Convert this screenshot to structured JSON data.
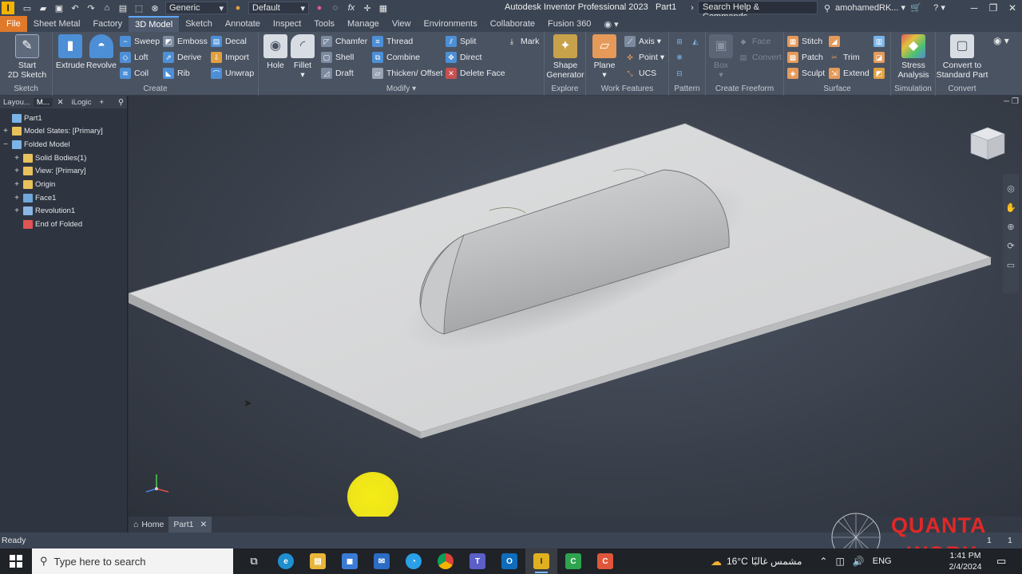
{
  "titlebar": {
    "app_title": "Autodesk Inventor Professional 2023",
    "doc_name": "Part1",
    "material": "Generic",
    "appearance": "Default",
    "search_placeholder": "Search Help & Commands...",
    "user": "amohamedRK..."
  },
  "tabs": [
    "File",
    "Sheet Metal",
    "Factory",
    "3D Model",
    "Sketch",
    "Annotate",
    "Inspect",
    "Tools",
    "Manage",
    "View",
    "Environments",
    "Collaborate",
    "Fusion 360"
  ],
  "ribbon": {
    "sketch": {
      "label": "Sketch",
      "start": "Start",
      "sketch2d": "2D Sketch"
    },
    "create": {
      "label": "Create",
      "extrude": "Extrude",
      "revolve": "Revolve",
      "sweep": "Sweep",
      "loft": "Loft",
      "coil": "Coil",
      "emboss": "Emboss",
      "derive": "Derive",
      "rib": "Rib",
      "decal": "Decal",
      "import": "Import",
      "unwrap": "Unwrap"
    },
    "modify": {
      "label": "Modify",
      "hole": "Hole",
      "fillet": "Fillet",
      "chamfer": "Chamfer",
      "shell": "Shell",
      "draft": "Draft",
      "thread": "Thread",
      "combine": "Combine",
      "thicken": "Thicken/ Offset",
      "split": "Split",
      "direct": "Direct",
      "delete_face": "Delete Face",
      "mark": "Mark"
    },
    "explore": {
      "label": "Explore",
      "shape1": "Shape",
      "shape2": "Generator"
    },
    "work": {
      "label": "Work Features",
      "plane": "Plane",
      "axis": "Axis",
      "point": "Point",
      "ucs": "UCS"
    },
    "pattern": {
      "label": "Pattern"
    },
    "freeform": {
      "label": "Create Freeform",
      "box": "Box",
      "face": "Face",
      "convert": "Convert"
    },
    "surface": {
      "label": "Surface",
      "stitch": "Stitch",
      "patch": "Patch",
      "sculpt": "Sculpt",
      "trim": "Trim",
      "extend": "Extend"
    },
    "simulation": {
      "label": "Simulation",
      "stress1": "Stress",
      "stress2": "Analysis"
    },
    "convert": {
      "label": "Convert",
      "c1": "Convert to",
      "c2": "Standard Part"
    }
  },
  "browser": {
    "tabs": [
      "Layou...",
      "M...",
      "iLogic"
    ],
    "tree": [
      {
        "label": "Part1",
        "indent": 0,
        "exp": "",
        "color": "#7ab4e8"
      },
      {
        "label": "Model States: [Primary]",
        "indent": 0,
        "exp": "+",
        "color": "#e8c15a"
      },
      {
        "label": "Folded Model",
        "indent": 0,
        "exp": "−",
        "color": "#7ab4e8"
      },
      {
        "label": "Solid Bodies(1)",
        "indent": 1,
        "exp": "+",
        "color": "#e8c15a"
      },
      {
        "label": "View: [Primary]",
        "indent": 1,
        "exp": "+",
        "color": "#e8c15a"
      },
      {
        "label": "Origin",
        "indent": 1,
        "exp": "+",
        "color": "#e8c15a"
      },
      {
        "label": "Face1",
        "indent": 1,
        "exp": "+",
        "color": "#6fa8dc"
      },
      {
        "label": "Revolution1",
        "indent": 1,
        "exp": "+",
        "color": "#8ab6e6"
      },
      {
        "label": "End of Folded",
        "indent": 1,
        "exp": "",
        "color": "#e05454"
      }
    ]
  },
  "doctabs": {
    "home": "Home",
    "part": "Part1"
  },
  "status": {
    "text": "Ready",
    "count1": "1",
    "count2": "1"
  },
  "taskbar": {
    "search_placeholder": "Type here to search",
    "weather": "16°C",
    "weather_desc": "مشمس غالبًا",
    "lang": "ENG",
    "time": "1:41 PM",
    "date": "2/4/2024"
  },
  "watermark": {
    "line1": "QUANTA",
    "line2": "WORX"
  },
  "colors": {
    "accent": "#e07a2a",
    "active_tab": "#5ea8ff",
    "cursor_highlight": "#f4ec14"
  }
}
